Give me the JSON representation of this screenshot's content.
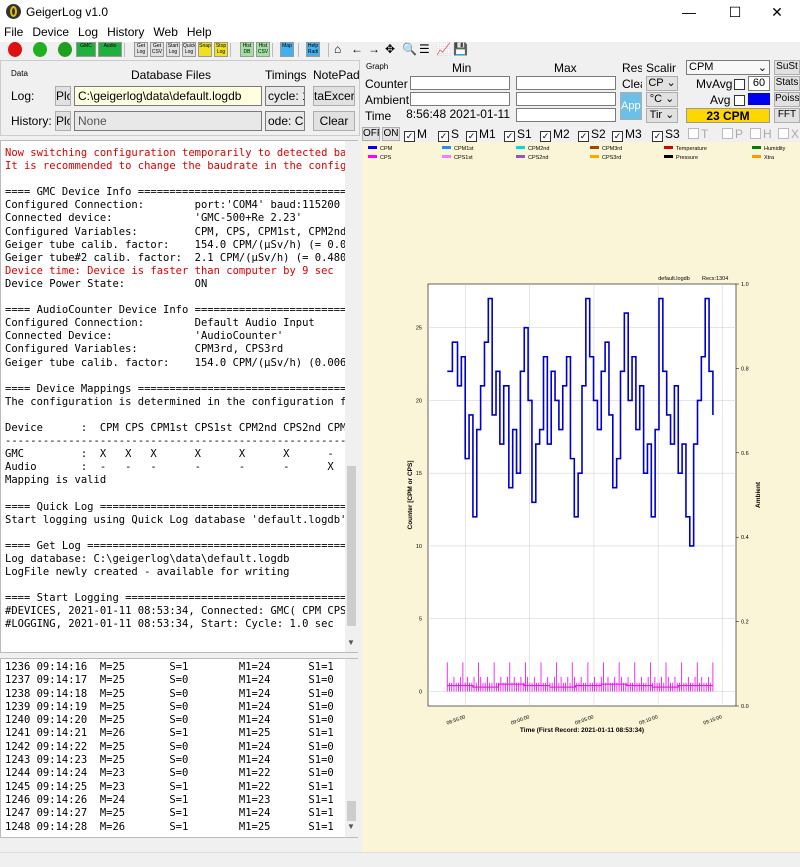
{
  "window": {
    "title": "GeigerLog v1.0",
    "controls": [
      "—",
      "☐",
      "✕"
    ]
  },
  "menu": [
    "File",
    "Device",
    "Log",
    "History",
    "Web",
    "Help"
  ],
  "toolbar": {
    "buttons": [
      {
        "id": "stop",
        "label": "",
        "color": "#e01010"
      },
      {
        "id": "power",
        "label": "",
        "color": "#20b020"
      },
      {
        "id": "gmc-power",
        "label": "",
        "color": "#20a020"
      },
      {
        "id": "gmc",
        "label": "GMC",
        "color": "#20b040"
      },
      {
        "id": "audio",
        "label": "Audio",
        "color": "#20b040"
      },
      {
        "id": "get-log",
        "label": "Get Log",
        "color": "#e0e0e0"
      },
      {
        "id": "get-csv",
        "label": "Get CSV",
        "color": "#e0e0e0"
      },
      {
        "id": "start-log",
        "label": "Start Log",
        "color": "#e0e0e0"
      },
      {
        "id": "quick-log",
        "label": "Quick Log",
        "color": "#e0e0e0"
      },
      {
        "id": "snap",
        "label": "Snap",
        "color": "#f0e020"
      },
      {
        "id": "stop-log",
        "label": "Stop Log",
        "color": "#f0e020"
      },
      {
        "id": "hist-db",
        "label": "Hist DB",
        "color": "#a0e0a0"
      },
      {
        "id": "hist-csv",
        "label": "Hist CSV",
        "color": "#a0e0a0"
      },
      {
        "id": "map",
        "label": "Map",
        "color": "#40b0f0"
      },
      {
        "id": "help-radio",
        "label": "Help Radi",
        "color": "#40b0f0"
      }
    ],
    "plot_tools": [
      "⌂",
      "←",
      "→",
      "✥",
      "🔍",
      "☰",
      "📈",
      "💾"
    ]
  },
  "data_panel": {
    "group_label": "Data",
    "db_files_label": "Database Files",
    "timings_label": "Timings",
    "notepad_label": "NotePad",
    "log_label": "Log:",
    "log_button": "Plo",
    "log_path": "C:\\geigerlog\\data\\default.logdb",
    "cycle": "cycle: 1",
    "history_label": "History:",
    "history_button": "Plo",
    "history_path": "None",
    "mode": "ode: CP",
    "tab_button": "taExcer",
    "clear_button": "Clear"
  },
  "graph_panel": {
    "label": "Graph",
    "min_label": "Min",
    "max_label": "Max",
    "reset": "Rese",
    "scaling": "Scaling",
    "clear": "Clea",
    "apply": "Apply",
    "rows": [
      {
        "label": "Counter",
        "min": "",
        "max": ""
      },
      {
        "label": "Ambient",
        "min": "",
        "max": ""
      },
      {
        "label": "Time",
        "min": "2021-01-11 08:56:48",
        "max": ""
      }
    ],
    "scale_selects": [
      "CP ⌄",
      "°C ⌄",
      "Tir ⌄"
    ],
    "var_select": "CPM",
    "ambient_select": "Temperature",
    "suSt": "SuSt",
    "stats": "Stats",
    "poiss": "Poiss",
    "fft": "FFT",
    "mvavg_label": "MvAvg",
    "mvavg_value": "60",
    "avg_label": "Avg",
    "avg_color": "#0000ee",
    "current_reading": "23 CPM",
    "reading_bg": "#ffd700"
  },
  "var_checks": {
    "off": "OFF",
    "on": "ON",
    "items": [
      {
        "label": "M",
        "checked": true,
        "enabled": true
      },
      {
        "label": "S",
        "checked": true,
        "enabled": true
      },
      {
        "label": "M1",
        "checked": true,
        "enabled": true
      },
      {
        "label": "S1",
        "checked": true,
        "enabled": true
      },
      {
        "label": "M2",
        "checked": true,
        "enabled": true
      },
      {
        "label": "S2",
        "checked": true,
        "enabled": true
      },
      {
        "label": "M3",
        "checked": true,
        "enabled": true
      },
      {
        "label": "S3",
        "checked": true,
        "enabled": true
      },
      {
        "label": "T",
        "checked": false,
        "enabled": false
      },
      {
        "label": "P",
        "checked": false,
        "enabled": false
      },
      {
        "label": "H",
        "checked": false,
        "enabled": false
      },
      {
        "label": "X",
        "checked": false,
        "enabled": false
      }
    ]
  },
  "legend": [
    [
      {
        "name": "CPM",
        "color": "#0000ff"
      },
      {
        "name": "CPM1st",
        "color": "#1e90ff"
      },
      {
        "name": "CPM2nd",
        "color": "#00dddd"
      },
      {
        "name": "CPM3rd",
        "color": "#aa4400"
      },
      {
        "name": "Temperature",
        "color": "#dd0000"
      },
      {
        "name": "Humidity",
        "color": "#008000"
      }
    ],
    [
      {
        "name": "CPS",
        "color": "#ff00ff"
      },
      {
        "name": "CPS1st",
        "color": "#ee82ee"
      },
      {
        "name": "CPS2nd",
        "color": "#9955bb"
      },
      {
        "name": "CPS3rd",
        "color": "#ffa500"
      },
      {
        "name": "Pressure",
        "color": "#000000"
      },
      {
        "name": "Xtra",
        "color": "#ff9900"
      }
    ]
  ],
  "notepad_lines": [
    {
      "text": "Now switching configuration temporarily to detected bau",
      "red": true
    },
    {
      "text": "It is recommended to change the baudrate in the config",
      "red": true
    },
    {
      "text": "",
      "red": false
    },
    {
      "text": "==== GMC Device Info ===================================",
      "red": false
    },
    {
      "text": "Configured Connection:        port:'COM4' baud:115200 t",
      "red": false
    },
    {
      "text": "Connected device:             'GMC-500+Re 2.23'",
      "red": false
    },
    {
      "text": "Configured Variables:         CPM, CPS, CPM1st, CPM2nd",
      "red": false
    },
    {
      "text": "Geiger tube calib. factor:    154.0 CPM/(µSv/h) (= 0.00",
      "red": false
    },
    {
      "text": "Geiger tube#2 calib. factor:  2.1 CPM/(µSv/h) (= 0.4808",
      "red": false
    },
    {
      "text": "Device time: Device is faster than computer by 9 sec",
      "red": true
    },
    {
      "text": "Device Power State:           ON",
      "red": false
    },
    {
      "text": "",
      "red": false
    },
    {
      "text": "==== AudioCounter Device Info ==========================",
      "red": false
    },
    {
      "text": "Configured Connection:        Default Audio Input",
      "red": false
    },
    {
      "text": "Connected Device:             'AudioCounter'",
      "red": false
    },
    {
      "text": "Configured Variables:         CPM3rd, CPS3rd",
      "red": false
    },
    {
      "text": "Geiger tube calib. factor:    154.0 CPM/(µSv/h) (0.0065",
      "red": false
    },
    {
      "text": "",
      "red": false
    },
    {
      "text": "==== Device Mappings ===================================",
      "red": false
    },
    {
      "text": "The configuration is determined in the configuration fi",
      "red": false
    },
    {
      "text": "",
      "red": false
    },
    {
      "text": "Device      :  CPM CPS CPM1st CPS1st CPM2nd CPS2nd CPM3",
      "red": false
    },
    {
      "text": "-------------------------------------------------------",
      "red": false
    },
    {
      "text": "GMC         :  X   X   X      X      X      X      -",
      "red": false
    },
    {
      "text": "Audio       :  -   -   -      -      -      -      X",
      "red": false
    },
    {
      "text": "Mapping is valid",
      "red": false
    },
    {
      "text": "",
      "red": false
    },
    {
      "text": "==== Quick Log ========================================",
      "red": false
    },
    {
      "text": "Start logging using Quick Log database 'default.logdb'",
      "red": false
    },
    {
      "text": "",
      "red": false
    },
    {
      "text": "==== Get Log ==========================================",
      "red": false
    },
    {
      "text": "Log database: C:\\geigerlog\\data\\default.logdb",
      "red": false
    },
    {
      "text": "LogFile newly created - available for writing",
      "red": false
    },
    {
      "text": "",
      "red": false
    },
    {
      "text": "==== Start Logging ====================================",
      "red": false
    },
    {
      "text": "#DEVICES, 2021-01-11 08:53:34, Connected: GMC( CPM CPS",
      "red": false
    },
    {
      "text": "#LOGGING, 2021-01-11 08:53:34, Start: Cycle: 1.0 sec",
      "red": false
    }
  ],
  "log_lines": [
    "1236 09:14:16  M=25       S=1        M1=24      S1=1",
    "1237 09:14:17  M=25       S=0        M1=24      S1=0",
    "1238 09:14:18  M=25       S=0        M1=24      S1=0",
    "1239 09:14:19  M=25       S=0        M1=24      S1=0",
    "1240 09:14:20  M=25       S=0        M1=24      S1=0",
    "1241 09:14:21  M=26       S=1        M1=25      S1=1",
    "1242 09:14:22  M=25       S=0        M1=24      S1=0",
    "1243 09:14:23  M=25       S=0        M1=24      S1=0",
    "1244 09:14:24  M=23       S=0        M1=22      S1=0",
    "1245 09:14:25  M=23       S=1        M1=22      S1=1",
    "1246 09:14:26  M=24       S=1        M1=23      S1=1",
    "1247 09:14:27  M=25       S=1        M1=24      S1=1",
    "1248 09:14:28  M=26       S=1        M1=25      S1=1"
  ],
  "chart_data": {
    "type": "line",
    "title_left": "default.logdb",
    "title_right": "Recs:1304",
    "xlabel": "Time (First Record: 2021-01-11 08:53:34)",
    "ylabel": "Counter [CPM or CPS]",
    "ylabel_right": "Ambient",
    "ylim": [
      -1,
      28
    ],
    "y_ticks": [
      "0",
      "5",
      "10",
      "15",
      "20",
      "25"
    ],
    "y_tick_values": [
      0,
      5,
      10,
      15,
      20,
      25
    ],
    "y2_ticks": [
      "0.0",
      "0.2",
      "0.4",
      "0.6",
      "0.8",
      "1.0"
    ],
    "y2_tick_values": [
      0,
      0.2,
      0.4,
      0.6,
      0.8,
      1.0
    ],
    "y2lim": [
      0,
      1
    ],
    "xlim_min": [
      -1.5,
      22.5
    ],
    "x_ticks": [
      "08:55:00",
      "09:00:00",
      "09:05:00",
      "09:10:00",
      "09:15:00"
    ],
    "x_tick_values": [
      1.43,
      6.43,
      11.43,
      16.43,
      21.43
    ],
    "grid": true,
    "series": [
      {
        "name": "CPM",
        "color": "#0000cc",
        "x": [
          0,
          0.4,
          0.8,
          1.1,
          1.4,
          1.7,
          2.0,
          2.3,
          2.6,
          2.9,
          3.2,
          3.5,
          3.8,
          4.1,
          4.4,
          4.8,
          5.1,
          5.4,
          5.7,
          6.0,
          6.3,
          6.6,
          6.9,
          7.2,
          7.5,
          7.8,
          8.1,
          8.4,
          8.7,
          9.0,
          9.3,
          9.6,
          9.9,
          10.2,
          10.5,
          10.8,
          11.1,
          11.4,
          11.7,
          12.0,
          12.3,
          12.6,
          12.9,
          13.2,
          13.5,
          13.8,
          14.1,
          14.4,
          14.7,
          15.0,
          15.3,
          15.6,
          15.9,
          16.2,
          16.5,
          16.8,
          17.1,
          17.4,
          17.7,
          18.0,
          18.3,
          18.6,
          18.9,
          19.2,
          19.5,
          19.8,
          20.1,
          20.4,
          20.7
        ],
        "values": [
          22,
          24,
          21,
          23,
          16,
          19,
          12,
          18,
          21,
          24,
          27,
          19,
          22,
          17,
          21,
          14,
          18,
          15,
          22,
          25,
          20,
          13,
          17,
          18,
          23,
          17,
          22,
          20,
          18,
          21,
          23,
          16,
          12,
          15,
          21,
          27,
          23,
          20,
          18,
          22,
          24,
          19,
          14,
          16,
          22,
          26,
          20,
          23,
          18,
          21,
          15,
          17,
          12,
          18,
          27,
          22,
          19,
          17,
          21,
          15,
          17,
          12,
          10,
          17,
          20,
          23,
          27,
          22,
          19
        ]
      },
      {
        "name": "CPS",
        "color": "#ee00ee",
        "x": [
          0,
          2,
          4,
          6,
          8,
          10,
          12,
          14,
          16,
          18,
          20.7
        ],
        "values": [
          0.4,
          0.3,
          0.5,
          0.4,
          0.3,
          0.4,
          0.5,
          0.4,
          0.3,
          0.4,
          0.4
        ]
      }
    ]
  }
}
